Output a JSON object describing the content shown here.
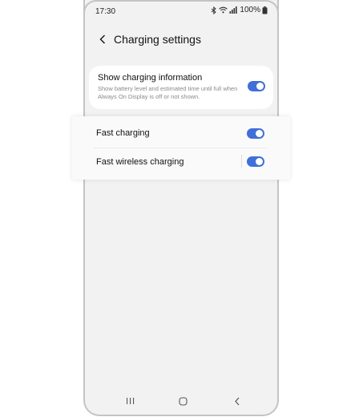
{
  "status_bar": {
    "time": "17:30",
    "battery": "100%",
    "icons": [
      "bluetooth-icon",
      "wifi-icon",
      "signal-icon",
      "battery-icon"
    ]
  },
  "header": {
    "title": "Charging settings",
    "back_icon": "chevron-left-icon"
  },
  "show_charging_info": {
    "title": "Show charging information",
    "description": "Show battery level and estimated time until full when Always On Display is off or not shown.",
    "enabled": true
  },
  "fast_charging": {
    "title": "Fast charging",
    "enabled": true
  },
  "fast_wireless_charging": {
    "title": "Fast wireless charging",
    "enabled": true
  },
  "nav_bar": {
    "icons": [
      "recents-icon",
      "home-icon",
      "back-icon"
    ]
  },
  "colors": {
    "toggle_on": "#3f6fd8",
    "screen_background": "#f2f2f3",
    "card_background": "#ffffff"
  }
}
